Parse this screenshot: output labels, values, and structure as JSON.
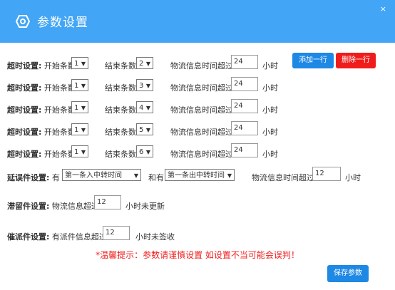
{
  "window": {
    "title": "参数设置",
    "close": "×"
  },
  "timeout_rows": [
    {
      "label": "超时设置:",
      "start_label": "开始条数",
      "start": "1",
      "end_label": "结束条数",
      "end": "2",
      "info_label": "物流信息时间超过",
      "hours": "24",
      "unit": "小时"
    },
    {
      "label": "超时设置:",
      "start_label": "开始条数",
      "start": "1",
      "end_label": "结束条数",
      "end": "3",
      "info_label": "物流信息时间超过",
      "hours": "24",
      "unit": "小时"
    },
    {
      "label": "超时设置:",
      "start_label": "开始条数",
      "start": "1",
      "end_label": "结束条数",
      "end": "4",
      "info_label": "物流信息时间超过",
      "hours": "24",
      "unit": "小时"
    },
    {
      "label": "超时设置:",
      "start_label": "开始条数",
      "start": "1",
      "end_label": "结束条数",
      "end": "5",
      "info_label": "物流信息时间超过",
      "hours": "24",
      "unit": "小时"
    },
    {
      "label": "超时设置:",
      "start_label": "开始条数",
      "start": "1",
      "end_label": "结束条数",
      "end": "6",
      "info_label": "物流信息时间超过",
      "hours": "24",
      "unit": "小时"
    }
  ],
  "buttons": {
    "add_row": "添加一行",
    "delete_row": "删除一行",
    "save": "保存参数"
  },
  "delay": {
    "label": "延误件设置:",
    "has1": "有",
    "select1": "第一条入中转时间",
    "has2": "和有",
    "select2": "第一条出中转时间",
    "info_label": "物流信息时间超过",
    "hours": "12",
    "unit": "小时"
  },
  "stay": {
    "label": "滞留件设置:",
    "info_label": "物流信息超过",
    "hours": "12",
    "unit": "小时未更新"
  },
  "dispatch": {
    "label": "催派件设置:",
    "info_label": "有派件信息超过",
    "hours": "12",
    "unit": "小时未签收"
  },
  "tip": "*温馨提示：参数请谨慎设置 如设置不当可能会误判！",
  "colors": {
    "header": "#42a5f5",
    "primary": "#1e88e5",
    "danger": "#f01c1c",
    "tip": "#f02020"
  }
}
